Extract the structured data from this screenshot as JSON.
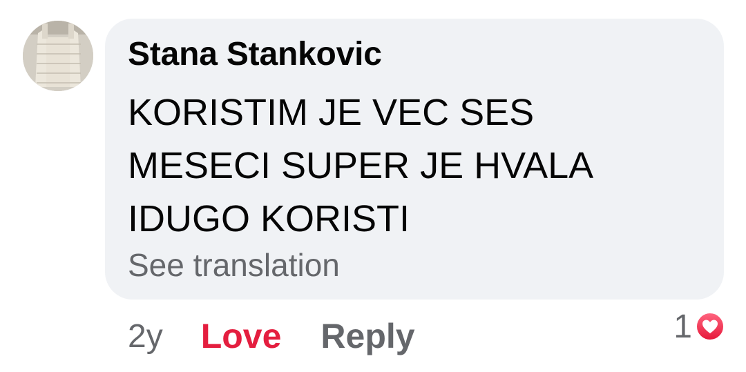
{
  "comment": {
    "author": "Stana Stankovic",
    "text_lines": [
      "KORISTIM JE VEC SES",
      "MESECI SUPER JE HVALA",
      "IDUGO KORISTI"
    ],
    "see_translation": "See translation"
  },
  "actions": {
    "time": "2y",
    "love": "Love",
    "reply": "Reply"
  },
  "reactions": {
    "count": "1",
    "icon": "love-reaction-icon"
  },
  "colors": {
    "bubble": "#f0f2f5",
    "love_red": "#e41e3f",
    "muted": "#65676b",
    "text": "#050505"
  }
}
